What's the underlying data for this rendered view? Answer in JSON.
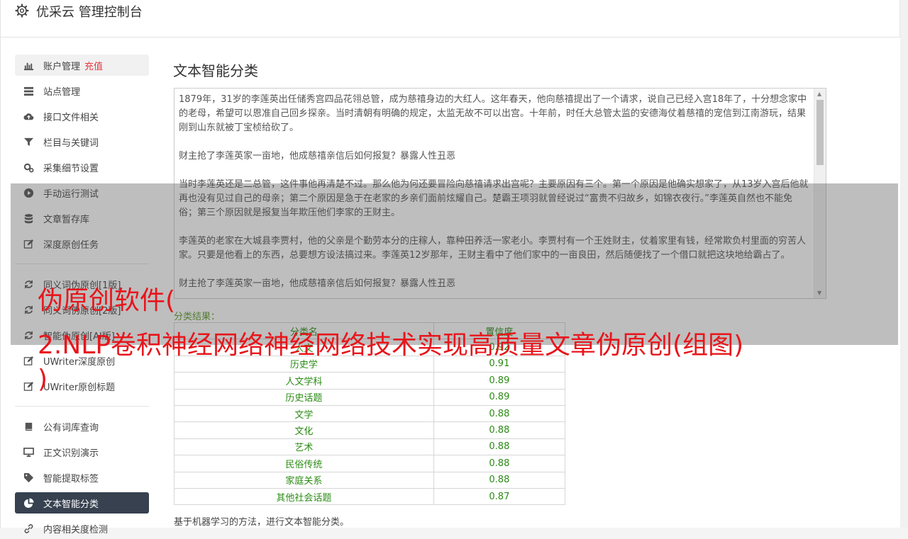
{
  "header": {
    "title": "优采云 管理控制台",
    "icon": "gear-icon"
  },
  "sidebar": {
    "items": [
      {
        "label": "账户管理",
        "badge": "充值",
        "icon": "bar-chart-icon"
      },
      {
        "label": "站点管理",
        "icon": "server-icon"
      },
      {
        "label": "接口文件相关",
        "icon": "cloud-upload-icon"
      },
      {
        "label": "栏目与关键词",
        "icon": "filter-icon"
      },
      {
        "label": "采集细节设置",
        "icon": "cogs-icon"
      },
      {
        "label": "手动运行测试",
        "icon": "play-circle-icon"
      },
      {
        "label": "文章暂存库",
        "icon": "database-icon"
      },
      {
        "label": "深度原创任务",
        "icon": "edit-icon"
      },
      {
        "label": "同义词伪原创[1版]",
        "icon": "refresh-icon"
      },
      {
        "label": "同义词伪原创[2版]",
        "icon": "refresh-icon"
      },
      {
        "label": "智能伪原创[AI版]",
        "icon": "refresh-icon"
      },
      {
        "label": "UWriter深度原创",
        "icon": "edit-icon"
      },
      {
        "label": "UWriter原创标题",
        "icon": "edit-icon"
      },
      {
        "label": "公有词库查询",
        "icon": "book-icon"
      },
      {
        "label": "正文识别演示",
        "icon": "monitor-icon"
      },
      {
        "label": "智能提取标签",
        "icon": "tag-icon"
      },
      {
        "label": "文本智能分类",
        "icon": "pie-chart-icon"
      },
      {
        "label": "内容相关度检测",
        "icon": "link-icon"
      }
    ]
  },
  "main": {
    "title": "文本智能分类",
    "paragraphs": [
      "1879年，31岁的李莲英出任储秀宫四品花翎总管，成为慈禧身边的大红人。这年春天，他向慈禧提出了一个请求，说自己已经入宫18年了，十分想念家中的老母，希望可以恩准自己回乡探亲。当时清朝有明确的规定，太监无故不可以出宫。十年前，时任大总管太监的安德海仗着慈禧的宠信到江南游玩，结果刚到山东就被丁宝桢给砍了。",
      "财主抢了李莲英家一亩地，他成慈禧亲信后如何报复？暴露人性丑恶",
      "当时李莲英还是二总管，这件事他再清楚不过。那么他为何还要冒险向慈禧请求出宫呢？主要原因有三个。第一个原因是他确实想家了，从13岁入宫后他就再也没有见过自己的母亲；第二个原因是急于在老家的乡亲们面前炫耀自己。楚霸王项羽就曾经说过“富贵不归故乡，如锦衣夜行。”李莲英自然也不能免俗；第三个原因就是报复当年欺压他们李家的王财主。",
      "李莲英的老家在大城县李贾村，他的父亲是个勤劳本分的庄稼人，靠种田养活一家老小。李贾村有一个王姓财主，仗着家里有钱，经常欺负村里面的穷苦人家。只要是他看上的东西，总要想方设法搞过来。李莲英12岁那年，王财主看中了他们家中的一亩良田，然后随便找了一个借口就把这块地给霸占了。",
      "财主抢了李莲英家一亩地，他成慈禧亲信后如何报复？暴露人性丑恶"
    ],
    "result_label": "分类结果：",
    "table": {
      "headers": [
        "分类名",
        "置信度"
      ],
      "rows": [
        [
          "人文",
          "0.92"
        ],
        [
          "历史学",
          "0.91"
        ],
        [
          "人文学科",
          "0.89"
        ],
        [
          "历史话题",
          "0.89"
        ],
        [
          "文学",
          "0.88"
        ],
        [
          "文化",
          "0.88"
        ],
        [
          "艺术",
          "0.88"
        ],
        [
          "民俗传统",
          "0.88"
        ],
        [
          "家庭关系",
          "0.88"
        ],
        [
          "其他社会话题",
          "0.87"
        ]
      ]
    },
    "footer": "基于机器学习的方法，进行文本智能分类。"
  },
  "overlay": {
    "line1": "伪原创软件(",
    "line2": "2.NLP卷积神经网络神经网络技术实现高质量文章伪原创(组图)",
    "line3": ")"
  },
  "colors": {
    "overlay_text": "#e8151b",
    "table_text": "#2a8b13",
    "selected_bg": "#37414f",
    "recharge": "#e4393c"
  }
}
